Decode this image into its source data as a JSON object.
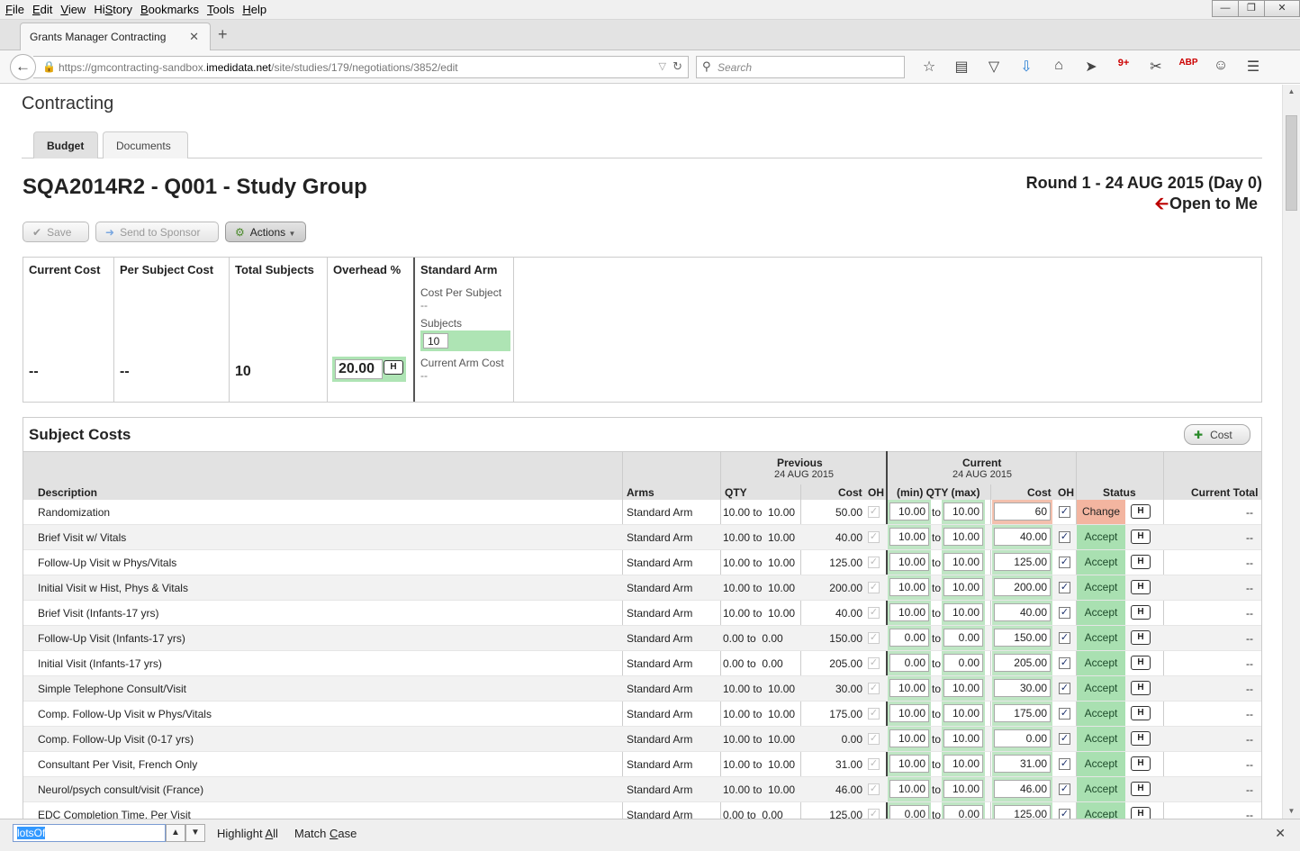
{
  "menu": [
    "File",
    "Edit",
    "View",
    "History",
    "Bookmarks",
    "Tools",
    "Help"
  ],
  "menu_access_keys": [
    "F",
    "E",
    "V",
    "S",
    "B",
    "T",
    "H"
  ],
  "browser": {
    "tab_title": "Grants Manager Contracting",
    "url_prefix": "https://gmcontracting-sandbox.",
    "url_host": "imedidata.net",
    "url_path": "/site/studies/179/negotiations/3852/edit",
    "search_placeholder": "Search",
    "toolbar_icons": [
      "star-icon",
      "reading-list-icon",
      "pocket-icon",
      "download-icon",
      "home-icon",
      "send-icon",
      "extension-icon",
      "screenshot-icon",
      "adblock-icon",
      "chat-icon",
      "hamburger-menu-icon"
    ],
    "extension_badge": "9+",
    "adblock_label": "ABP"
  },
  "page": {
    "app_title": "Contracting",
    "tabs": [
      "Budget",
      "Documents"
    ],
    "negotiation_title": "SQA2014R2 - Q001 - Study Group",
    "round": "Round 1 - 24 AUG 2015 (Day 0)",
    "open_status": "Open to Me",
    "buttons": {
      "save": "Save",
      "send": "Send to Sponsor",
      "actions": "Actions"
    }
  },
  "summary": {
    "current_cost_label": "Current Cost",
    "current_cost": "--",
    "per_subject_label": "Per Subject Cost",
    "per_subject": "--",
    "total_subjects_label": "Total Subjects",
    "total_subjects": "10",
    "overhead_label": "Overhead %",
    "overhead": "20.00",
    "h_label": "H",
    "arm": {
      "name": "Standard Arm",
      "cost_per_subject_label": "Cost Per Subject",
      "cost_per_subject": "--",
      "subjects_label": "Subjects",
      "subjects": "10",
      "current_arm_cost_label": "Current Arm Cost",
      "current_arm_cost": "--"
    }
  },
  "subject_costs": {
    "title": "Subject Costs",
    "add_cost_label": "Cost",
    "headers": {
      "description": "Description",
      "arms": "Arms",
      "previous": "Previous",
      "previous_date": "24 AUG 2015",
      "current": "Current",
      "current_date": "24 AUG 2015",
      "qty": "QTY",
      "cost": "Cost",
      "oh": "OH",
      "minmax": "(min) QTY (max)",
      "status": "Status",
      "current_total": "Current Total"
    },
    "to_label": "to",
    "rows": [
      {
        "desc": "Randomization",
        "arm": "Standard Arm",
        "pqty": "10.00 to  10.00",
        "pcost": "50.00",
        "min": "10.00",
        "max": "10.00",
        "cost": "60",
        "status": "Change",
        "total": "--"
      },
      {
        "desc": "Brief Visit w/ Vitals",
        "arm": "Standard Arm",
        "pqty": "10.00 to  10.00",
        "pcost": "40.00",
        "min": "10.00",
        "max": "10.00",
        "cost": "40.00",
        "status": "Accept",
        "total": "--"
      },
      {
        "desc": "Follow-Up Visit w Phys/Vitals",
        "arm": "Standard Arm",
        "pqty": "10.00 to  10.00",
        "pcost": "125.00",
        "min": "10.00",
        "max": "10.00",
        "cost": "125.00",
        "status": "Accept",
        "total": "--"
      },
      {
        "desc": "Initial Visit w Hist, Phys & Vitals",
        "arm": "Standard Arm",
        "pqty": "10.00 to  10.00",
        "pcost": "200.00",
        "min": "10.00",
        "max": "10.00",
        "cost": "200.00",
        "status": "Accept",
        "total": "--"
      },
      {
        "desc": "Brief Visit (Infants-17 yrs)",
        "arm": "Standard Arm",
        "pqty": "10.00 to  10.00",
        "pcost": "40.00",
        "min": "10.00",
        "max": "10.00",
        "cost": "40.00",
        "status": "Accept",
        "total": "--"
      },
      {
        "desc": "Follow-Up Visit (Infants-17 yrs)",
        "arm": "Standard Arm",
        "pqty": "0.00 to  0.00",
        "pcost": "150.00",
        "min": "0.00",
        "max": "0.00",
        "cost": "150.00",
        "status": "Accept",
        "total": "--"
      },
      {
        "desc": "Initial Visit (Infants-17 yrs)",
        "arm": "Standard Arm",
        "pqty": "0.00 to  0.00",
        "pcost": "205.00",
        "min": "0.00",
        "max": "0.00",
        "cost": "205.00",
        "status": "Accept",
        "total": "--"
      },
      {
        "desc": "Simple Telephone Consult/Visit",
        "arm": "Standard Arm",
        "pqty": "10.00 to  10.00",
        "pcost": "30.00",
        "min": "10.00",
        "max": "10.00",
        "cost": "30.00",
        "status": "Accept",
        "total": "--"
      },
      {
        "desc": "Comp. Follow-Up Visit w Phys/Vitals",
        "arm": "Standard Arm",
        "pqty": "10.00 to  10.00",
        "pcost": "175.00",
        "min": "10.00",
        "max": "10.00",
        "cost": "175.00",
        "status": "Accept",
        "total": "--"
      },
      {
        "desc": "Comp. Follow-Up Visit (0-17 yrs)",
        "arm": "Standard Arm",
        "pqty": "10.00 to  10.00",
        "pcost": "0.00",
        "min": "10.00",
        "max": "10.00",
        "cost": "0.00",
        "status": "Accept",
        "total": "--"
      },
      {
        "desc": "Consultant Per Visit, French Only",
        "arm": "Standard Arm",
        "pqty": "10.00 to  10.00",
        "pcost": "31.00",
        "min": "10.00",
        "max": "10.00",
        "cost": "31.00",
        "status": "Accept",
        "total": "--"
      },
      {
        "desc": "Neurol/psych consult/visit (France)",
        "arm": "Standard Arm",
        "pqty": "10.00 to  10.00",
        "pcost": "46.00",
        "min": "10.00",
        "max": "10.00",
        "cost": "46.00",
        "status": "Accept",
        "total": "--"
      },
      {
        "desc": "EDC Completion Time, Per Visit",
        "arm": "Standard Arm",
        "pqty": "0.00 to  0.00",
        "pcost": "125.00",
        "min": "0.00",
        "max": "0.00",
        "cost": "125.00",
        "status": "Accept",
        "total": "--"
      }
    ]
  },
  "findbar": {
    "query": "lotsOf",
    "highlight_all": "Highlight All",
    "highlight_all_key": "A",
    "match_case": "Match Case",
    "match_case_key": "C"
  },
  "colors": {
    "accept": "#a9e0b1",
    "change": "#f3b5a0",
    "green_field": "#aee4b4"
  }
}
